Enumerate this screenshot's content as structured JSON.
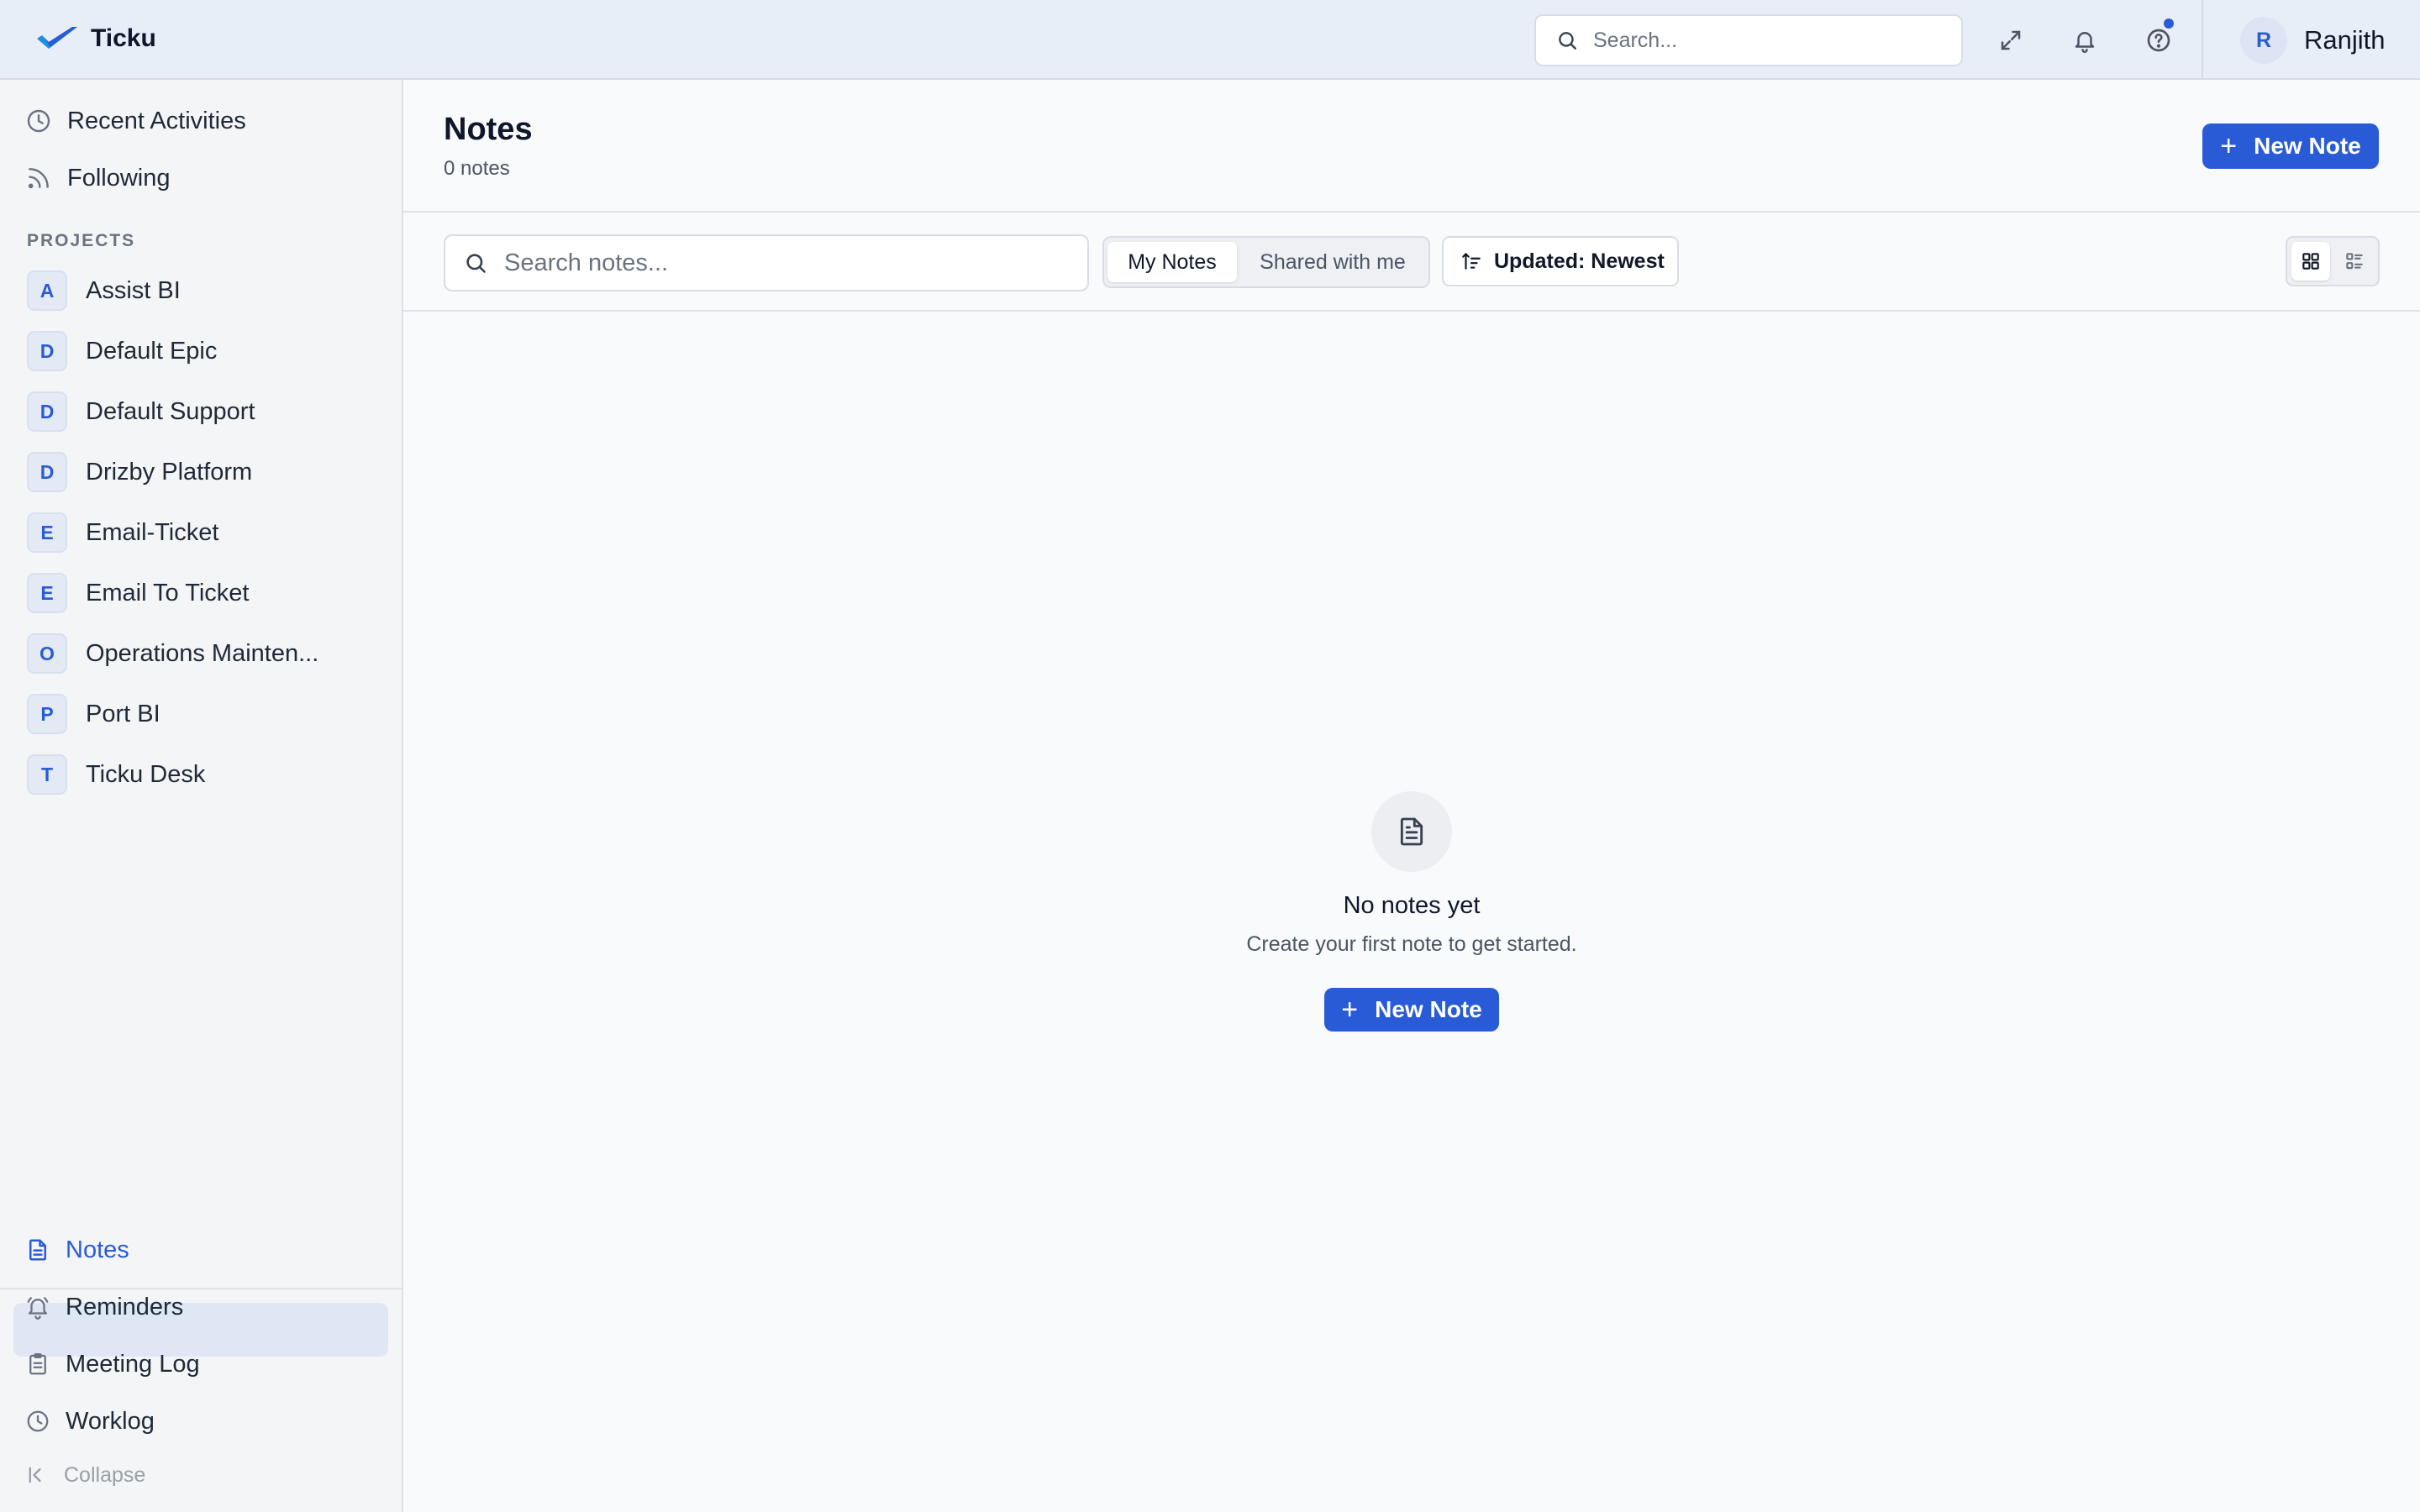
{
  "app": {
    "name": "Ticku"
  },
  "topbar": {
    "search_placeholder": "Search...",
    "user_initial": "R",
    "user_name": "Ranjith",
    "icons": [
      "expand-icon",
      "bell-icon",
      "help-icon"
    ]
  },
  "sidebar": {
    "nav": [
      {
        "label": "Recent Activities",
        "icon": "clock-icon"
      },
      {
        "label": "Following",
        "icon": "rss-icon"
      }
    ],
    "projects_heading": "PROJECTS",
    "projects": [
      {
        "initial": "A",
        "label": "Assist BI"
      },
      {
        "initial": "D",
        "label": "Default Epic"
      },
      {
        "initial": "D",
        "label": "Default Support"
      },
      {
        "initial": "D",
        "label": "Drizby Platform"
      },
      {
        "initial": "E",
        "label": "Email-Ticket"
      },
      {
        "initial": "E",
        "label": "Email To Ticket"
      },
      {
        "initial": "O",
        "label": "Operations Mainten..."
      },
      {
        "initial": "P",
        "label": "Port BI"
      },
      {
        "initial": "T",
        "label": "Ticku Desk"
      }
    ],
    "bottom": [
      {
        "label": "Notes",
        "icon": "note-icon",
        "active": true
      },
      {
        "label": "Reminders",
        "icon": "bell-ring-icon"
      },
      {
        "label": "Meeting Log",
        "icon": "clipboard-icon"
      },
      {
        "label": "Worklog",
        "icon": "clock-icon"
      }
    ],
    "collapse_label": "Collapse"
  },
  "header": {
    "title": "Notes",
    "count": "0 notes",
    "new_note_label": "New Note"
  },
  "toolbar": {
    "search_placeholder": "Search notes...",
    "tabs": [
      {
        "label": "My Notes",
        "selected": true
      },
      {
        "label": "Shared with me",
        "selected": false
      }
    ],
    "sort_label": "Updated: Newest",
    "view_modes": [
      "grid-view-icon",
      "list-view-icon"
    ],
    "selected_view": "grid"
  },
  "empty_state": {
    "title": "No notes yet",
    "subtitle": "Create your first note to get started.",
    "button_label": "New Note"
  },
  "colors": {
    "accent": "#2a5bd7",
    "topbar_bg": "#e8eef8",
    "sidebar_bg": "#f4f5f7",
    "active_item_bg": "#dfe6f4"
  }
}
